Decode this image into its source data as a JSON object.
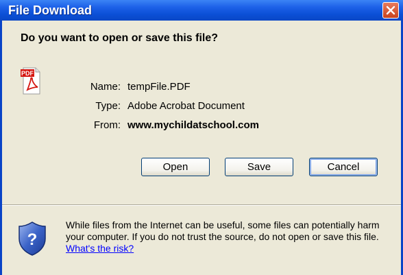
{
  "window": {
    "title": "File Download",
    "close_icon": "close-icon"
  },
  "dialog": {
    "question": "Do you want to open or save this file?",
    "file_icon": "pdf-file-icon",
    "name_label": "Name:",
    "name_value": "tempFile.PDF",
    "type_label": "Type:",
    "type_value": "Adobe Acrobat Document",
    "from_label": "From:",
    "from_value": "www.mychildatschool.com"
  },
  "buttons": {
    "open": "Open",
    "save": "Save",
    "cancel": "Cancel"
  },
  "warning": {
    "icon": "security-shield-icon",
    "text": "While files from the Internet can be useful, some files can potentially harm your computer. If you do not trust the source, do not open or save this file.",
    "link": "What's the risk?"
  },
  "colors": {
    "titlebar": "#0a4fd6",
    "client_bg": "#ece9d8",
    "close_button": "#c8431d",
    "link": "#0000ff"
  }
}
